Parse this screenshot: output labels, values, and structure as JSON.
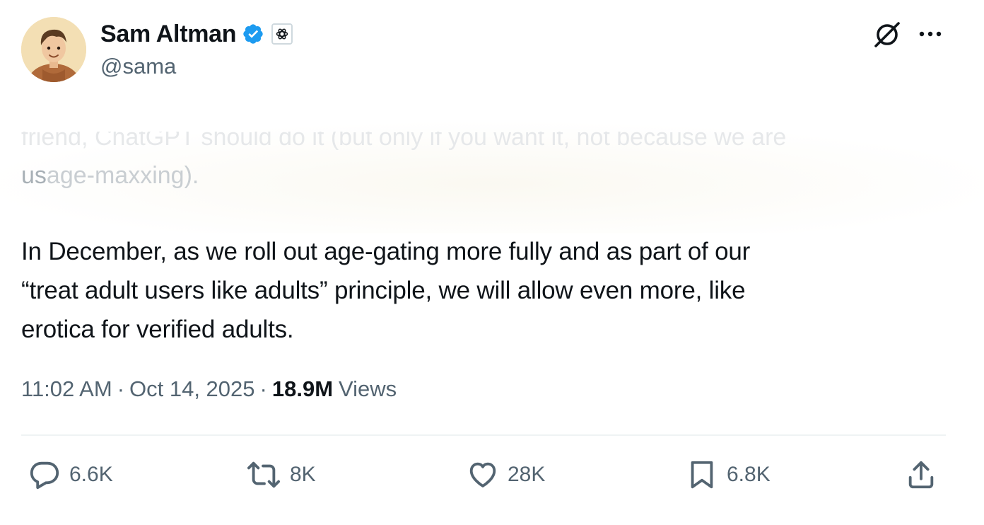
{
  "author": {
    "display_name": "Sam Altman",
    "handle": "@sama",
    "avatar_icon": "avatar-cartoon-portrait",
    "verified_icon": "verified-badge-icon",
    "affiliate_icon": "openai-logo-icon"
  },
  "header_actions": {
    "grok_icon": "grok-icon",
    "more_icon": "more-options-icon"
  },
  "faded_text": {
    "line1": "friend, ChatGPT should do it (but only if you want it, not because we are",
    "line2_start": "us",
    "line2_rest": "age-maxxing)."
  },
  "body_lines": [
    "In December, as we roll out age-gating more fully and as part of our",
    "“treat adult users like adults” principle, we will allow even more, like",
    "erotica for verified adults."
  ],
  "meta": {
    "time": "11:02 AM",
    "date": "Oct 14, 2025",
    "separator": "·",
    "views_count": "18.9M",
    "views_label": "Views"
  },
  "actions": {
    "replies": "6.6K",
    "reposts": "8K",
    "likes": "28K",
    "bookmarks": "6.8K"
  },
  "colors": {
    "text_primary": "#0f1419",
    "text_secondary": "#536471",
    "verified_blue": "#1d9bf0",
    "divider": "#eff3f4"
  }
}
